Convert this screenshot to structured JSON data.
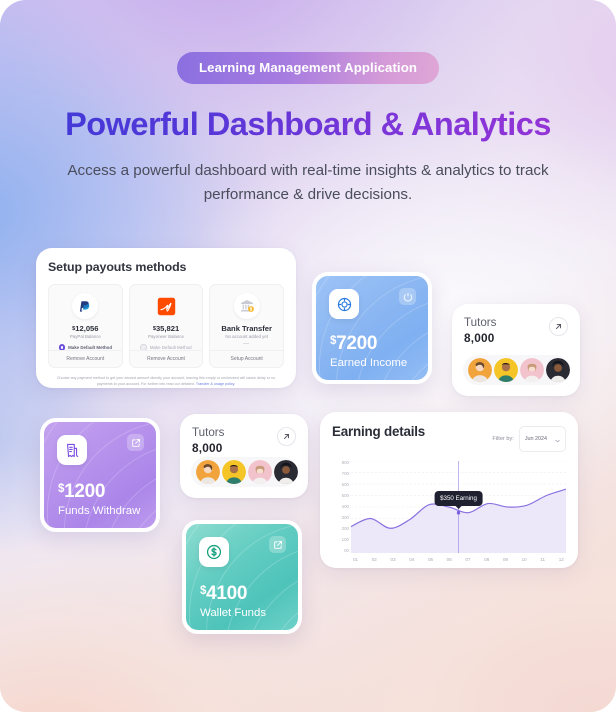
{
  "hero": {
    "badge": "Learning Management Application",
    "title": "Powerful Dashboard & Analytics",
    "subtitle": "Access a powerful dashboard with real-time insights & analytics to track performance & drive decisions."
  },
  "payouts": {
    "title": "Setup payouts methods",
    "methods": [
      {
        "logo_icon": "paypal-icon",
        "amount": "12,056",
        "currency": "$",
        "sub": "PayPal Balance",
        "default_label": "Make Default Method",
        "is_default": true,
        "action": "Remove Account"
      },
      {
        "logo_icon": "payoneer-icon",
        "amount": "35,821",
        "currency": "$",
        "sub": "Payoneer Balance",
        "default_label": "Make Default Method",
        "is_default": false,
        "action": "Remove Account"
      },
      {
        "logo_icon": "bank-icon",
        "amount": "Bank Transfer",
        "currency": "",
        "sub": "No account added yet",
        "dash": "—",
        "action": "Setup Account"
      }
    ],
    "note_text": "Choose any payment method to get your earned amount directly your account, leaving this empty or unchecked will cause delay or no payments to your account. For further info read our detailed.",
    "note_link": "Transfer & usage policy."
  },
  "tiles": [
    {
      "id": "earned",
      "amount": "7200",
      "currency": "$",
      "label": "Earned Income",
      "icon": "target-icon",
      "corner_icon": "refresh-icon",
      "color": "#8cb7f2"
    },
    {
      "id": "funds",
      "amount": "1200",
      "currency": "$",
      "label": "Funds Withdraw",
      "icon": "receipt-icon",
      "corner_icon": "external-link-icon",
      "color": "#b692ec"
    },
    {
      "id": "wallet",
      "amount": "4100",
      "currency": "$",
      "label": "Wallet Funds",
      "icon": "dollar-coin-icon",
      "corner_icon": "external-link-icon",
      "color": "#4ec3ba"
    }
  ],
  "tutors_cards": [
    {
      "title": "Tutors",
      "count": "8,000",
      "arrow_icon": "arrow-up-right-icon",
      "avatar_colors": [
        "#f2a43c",
        "#f5c427",
        "#f2c3cd",
        "#2a2b33"
      ]
    },
    {
      "title": "Tutors",
      "count": "8,000",
      "arrow_icon": "arrow-up-right-icon",
      "avatar_colors": [
        "#f2a43c",
        "#f5c427",
        "#f2c3cd",
        "#2a2b33"
      ]
    }
  ],
  "earning": {
    "title": "Earning details",
    "filter_label": "Filter by:",
    "filter_value": "Jun 2024",
    "filter_caret_icon": "chevron-down-icon",
    "tooltip": "$350 Earning"
  },
  "chart_data": {
    "type": "area",
    "title": "Earning details",
    "xlabel": "",
    "ylabel": "",
    "ylim": [
      0,
      800
    ],
    "grid": true,
    "legend_position": "none",
    "ytick_labels": [
      "800",
      "700",
      "600",
      "500",
      "400",
      "300",
      "200",
      "100",
      "00"
    ],
    "x": [
      "01",
      "02",
      "03",
      "04",
      "05",
      "06",
      "07",
      "08",
      "09",
      "10",
      "11",
      "12"
    ],
    "series": [
      {
        "name": "Earning",
        "values": [
          230,
          300,
          215,
          290,
          420,
          400,
          350,
          430,
          400,
          415,
          500,
          555
        ]
      }
    ],
    "highlight": {
      "x": "06",
      "value": 350,
      "label": "$350 Earning"
    },
    "line_color": "#8b72e0",
    "fill_color": "#ece8fa"
  }
}
